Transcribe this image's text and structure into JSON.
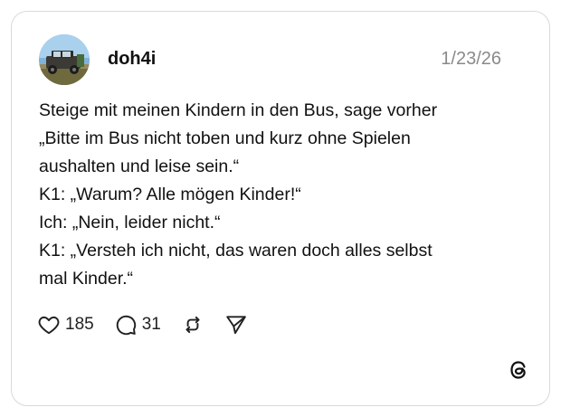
{
  "post": {
    "username": "doh4i",
    "date": "1/23/26",
    "lines": [
      "Steige mit meinen Kindern in den Bus, sage vorher",
      "„Bitte im Bus nicht toben und kurz ohne Spielen",
      "aushalten und leise sein.“",
      "K1: „Warum? Alle mögen Kinder!“",
      "Ich: „Nein, leider nicht.“",
      "K1: „Versteh ich nicht, das waren doch alles selbst",
      "mal Kinder.“"
    ]
  },
  "actions": {
    "like_icon": "heart-icon",
    "like_count": "185",
    "comment_icon": "comment-bubble-icon",
    "comment_count": "31",
    "repost_icon": "repost-icon",
    "share_icon": "send-icon"
  },
  "branding": {
    "logo": "threads-logo-icon"
  },
  "colors": {
    "text": "#111111",
    "muted": "#8a8a8a",
    "border": "#d9d9d9",
    "background": "#ffffff"
  }
}
